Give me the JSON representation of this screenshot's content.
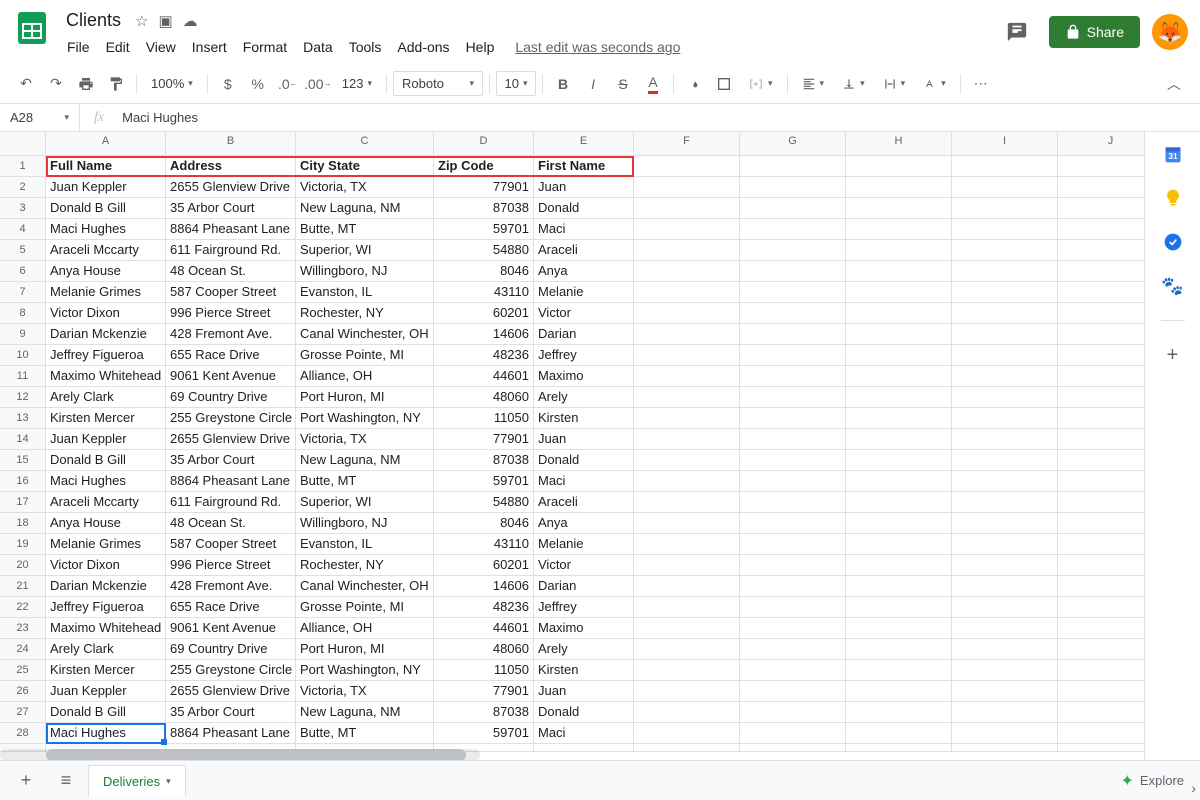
{
  "doc_title": "Clients",
  "menu": [
    "File",
    "Edit",
    "View",
    "Insert",
    "Format",
    "Data",
    "Tools",
    "Add-ons",
    "Help"
  ],
  "last_edit": "Last edit was seconds ago",
  "share_label": "Share",
  "toolbar": {
    "zoom": "100%",
    "currency": "$",
    "percent": "%",
    "dec_dec": ".0",
    "inc_dec": ".00",
    "numfmt": "123",
    "font": "Roboto",
    "fontsize": "10"
  },
  "cell_ref": "A28",
  "fx_value": "Maci Hughes",
  "columns": [
    "A",
    "B",
    "C",
    "D",
    "E",
    "F",
    "G",
    "H",
    "I",
    "J"
  ],
  "headers": [
    "Full Name",
    "Address",
    "City State",
    "Zip Code",
    "First Name"
  ],
  "rows": [
    {
      "n": 1,
      "a": "Full Name",
      "b": "Address",
      "c": "City State",
      "d": "Zip Code",
      "e": "First Name",
      "hdr": true
    },
    {
      "n": 2,
      "a": "Juan Keppler",
      "b": "2655  Glenview Drive",
      "c": "Victoria, TX",
      "d": "77901",
      "e": "Juan"
    },
    {
      "n": 3,
      "a": "Donald B Gill",
      "b": "35  Arbor Court",
      "c": "New Laguna, NM",
      "d": "87038",
      "e": "Donald"
    },
    {
      "n": 4,
      "a": "Maci Hughes",
      "b": "8864 Pheasant Lane",
      "c": "Butte, MT",
      "d": "59701",
      "e": "Maci"
    },
    {
      "n": 5,
      "a": "Araceli Mccarty",
      "b": "611 Fairground Rd.",
      "c": "Superior, WI",
      "d": "54880",
      "e": "Araceli"
    },
    {
      "n": 6,
      "a": "Anya House",
      "b": "48 Ocean St.",
      "c": "Willingboro, NJ",
      "d": "8046",
      "e": "Anya"
    },
    {
      "n": 7,
      "a": "Melanie Grimes",
      "b": "587 Cooper Street",
      "c": "Evanston, IL",
      "d": "43110",
      "e": "Melanie"
    },
    {
      "n": 8,
      "a": "Victor Dixon",
      "b": "996 Pierce Street",
      "c": "Rochester, NY",
      "d": "60201",
      "e": "Victor"
    },
    {
      "n": 9,
      "a": "Darian Mckenzie",
      "b": "428 Fremont Ave.",
      "c": "Canal Winchester, OH",
      "d": "14606",
      "e": "Darian"
    },
    {
      "n": 10,
      "a": "Jeffrey Figueroa",
      "b": "655 Race Drive",
      "c": "Grosse Pointe, MI",
      "d": "48236",
      "e": "Jeffrey"
    },
    {
      "n": 11,
      "a": "Maximo Whitehead",
      "b": "9061 Kent Avenue",
      "c": "Alliance, OH",
      "d": "44601",
      "e": "Maximo"
    },
    {
      "n": 12,
      "a": "Arely Clark",
      "b": "69 Country Drive",
      "c": "Port Huron, MI",
      "d": "48060",
      "e": "Arely"
    },
    {
      "n": 13,
      "a": "Kirsten Mercer",
      "b": "255 Greystone Circle",
      "c": "Port Washington, NY",
      "d": "11050",
      "e": "Kirsten"
    },
    {
      "n": 14,
      "a": "Juan Keppler",
      "b": "2655  Glenview Drive",
      "c": "Victoria, TX",
      "d": "77901",
      "e": "Juan"
    },
    {
      "n": 15,
      "a": "Donald B Gill",
      "b": "35  Arbor Court",
      "c": "New Laguna, NM",
      "d": "87038",
      "e": "Donald"
    },
    {
      "n": 16,
      "a": "Maci Hughes",
      "b": "8864 Pheasant Lane",
      "c": "Butte, MT",
      "d": "59701",
      "e": "Maci"
    },
    {
      "n": 17,
      "a": "Araceli Mccarty",
      "b": "611 Fairground Rd.",
      "c": "Superior, WI",
      "d": "54880",
      "e": "Araceli"
    },
    {
      "n": 18,
      "a": "Anya House",
      "b": "48 Ocean St.",
      "c": "Willingboro, NJ",
      "d": "8046",
      "e": "Anya"
    },
    {
      "n": 19,
      "a": "Melanie Grimes",
      "b": "587 Cooper Street",
      "c": "Evanston, IL",
      "d": "43110",
      "e": "Melanie"
    },
    {
      "n": 20,
      "a": "Victor Dixon",
      "b": "996 Pierce Street",
      "c": "Rochester, NY",
      "d": "60201",
      "e": "Victor"
    },
    {
      "n": 21,
      "a": "Darian Mckenzie",
      "b": "428 Fremont Ave.",
      "c": "Canal Winchester, OH",
      "d": "14606",
      "e": "Darian"
    },
    {
      "n": 22,
      "a": "Jeffrey Figueroa",
      "b": "655 Race Drive",
      "c": "Grosse Pointe, MI",
      "d": "48236",
      "e": "Jeffrey"
    },
    {
      "n": 23,
      "a": "Maximo Whitehead",
      "b": "9061 Kent Avenue",
      "c": "Alliance, OH",
      "d": "44601",
      "e": "Maximo"
    },
    {
      "n": 24,
      "a": "Arely Clark",
      "b": "69 Country Drive",
      "c": "Port Huron, MI",
      "d": "48060",
      "e": "Arely"
    },
    {
      "n": 25,
      "a": "Kirsten Mercer",
      "b": "255 Greystone Circle",
      "c": "Port Washington, NY",
      "d": "11050",
      "e": "Kirsten"
    },
    {
      "n": 26,
      "a": "Juan Keppler",
      "b": "2655  Glenview Drive",
      "c": "Victoria, TX",
      "d": "77901",
      "e": "Juan"
    },
    {
      "n": 27,
      "a": "Donald B Gill",
      "b": "35  Arbor Court",
      "c": "New Laguna, NM",
      "d": "87038",
      "e": "Donald"
    },
    {
      "n": 28,
      "a": "Maci Hughes",
      "b": "8864 Pheasant Lane",
      "c": "Butte, MT",
      "d": "59701",
      "e": "Maci",
      "sel": true
    }
  ],
  "sheet_tab": "Deliveries",
  "explore_label": "Explore"
}
